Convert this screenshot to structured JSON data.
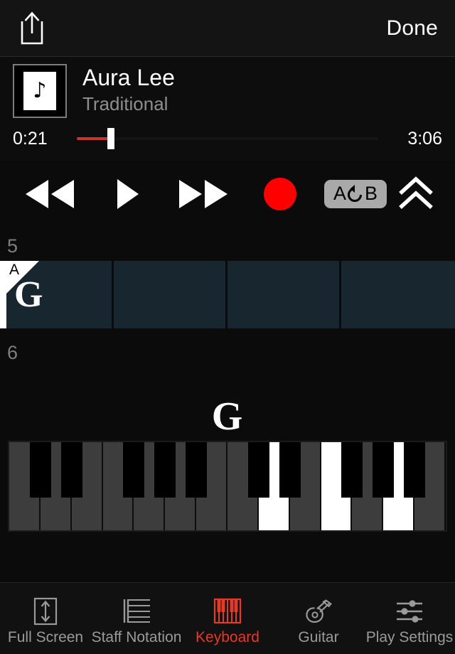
{
  "topbar": {
    "share_icon": "share-upload-icon",
    "done_label": "Done"
  },
  "song": {
    "title": "Aura Lee",
    "artist": "Traditional",
    "artwork_icon": "eighth-note-icon",
    "artwork_glyph": "♪"
  },
  "progress": {
    "elapsed": "0:21",
    "remaining": "3:06",
    "percent": 11.3,
    "fill_color": "#c0392b",
    "knob_color": "#ffffff"
  },
  "transport": {
    "rewind_label": "Rewind",
    "play_label": "Play",
    "fast_forward_label": "Fast Forward",
    "record_label": "Record",
    "record_color": "#fe0000",
    "loop_a_label": "A",
    "loop_b_label": "B",
    "loop_chip_color": "#a9a9a9",
    "expand_label": "Expand"
  },
  "tracks": {
    "measure_top": "5",
    "measure_bottom": "6",
    "loop_marker_label": "A",
    "chord_in_measure": "G",
    "beat_count": 4,
    "cell_color": "#18262f"
  },
  "instrument": {
    "chord_name": "G",
    "keyboard": {
      "white_key_count": 14,
      "highlighted_white_keys": [
        8,
        10,
        12
      ],
      "black_key_positions": [
        1,
        2,
        4,
        5,
        6,
        8,
        9,
        11,
        12,
        13
      ],
      "key_idle_color": "#3d3d3d",
      "key_active_color": "#ffffff",
      "black_key_color": "#000000"
    }
  },
  "tabbar": {
    "accent_color": "#e23b28",
    "items": [
      {
        "label": "Full Screen",
        "icon": "full-screen-icon",
        "active": false
      },
      {
        "label": "Staff Notation",
        "icon": "staff-notation-icon",
        "active": false
      },
      {
        "label": "Keyboard",
        "icon": "keyboard-icon",
        "active": true
      },
      {
        "label": "Guitar",
        "icon": "guitar-icon",
        "active": false
      },
      {
        "label": "Play Settings",
        "icon": "sliders-icon",
        "active": false
      }
    ]
  }
}
